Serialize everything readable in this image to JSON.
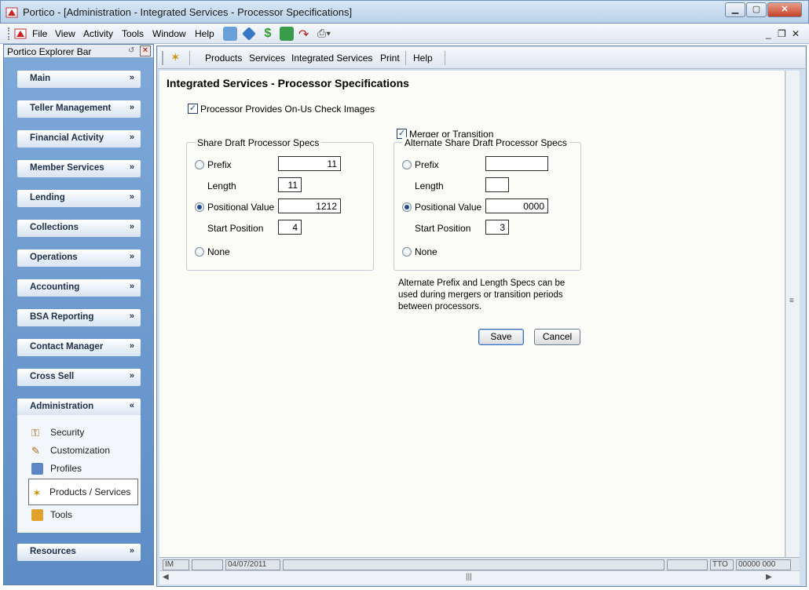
{
  "window": {
    "title": "Portico - [Administration - Integrated Services - Processor Specifications]",
    "min": "▁",
    "max": "▢",
    "close": "✕"
  },
  "menubar": {
    "items": [
      "File",
      "View",
      "Activity",
      "Tools",
      "Window",
      "Help"
    ],
    "mdi_min": "_",
    "mdi_restore": "❐",
    "mdi_close": "✕"
  },
  "explorer": {
    "title": "Portico Explorer Bar",
    "groups": [
      {
        "label": "Main",
        "chevron": "»"
      },
      {
        "label": "Teller Management",
        "chevron": "»"
      },
      {
        "label": "Financial Activity",
        "chevron": "»"
      },
      {
        "label": "Member Services",
        "chevron": "»"
      },
      {
        "label": "Lending",
        "chevron": "»"
      },
      {
        "label": "Collections",
        "chevron": "»"
      },
      {
        "label": "Operations",
        "chevron": "»"
      },
      {
        "label": "Accounting",
        "chevron": "»"
      },
      {
        "label": "BSA Reporting",
        "chevron": "»"
      },
      {
        "label": "Contact Manager",
        "chevron": "»"
      },
      {
        "label": "Cross Sell",
        "chevron": "»"
      },
      {
        "label": "Administration",
        "chevron": "«"
      },
      {
        "label": "Resources",
        "chevron": "»"
      }
    ],
    "admin_items": [
      "Security",
      "Customization",
      "Profiles",
      "Products / Services",
      "Tools"
    ],
    "selected_item": "Products / Services"
  },
  "toolbar": {
    "items": [
      "Products",
      "Services",
      "Integrated Services",
      "Print",
      "Help"
    ]
  },
  "form": {
    "title": "Integrated Services - Processor Specifications",
    "onus_label": "Processor Provides On-Us Check Images",
    "onus_checked": true,
    "merger_label": "Merger or Transition",
    "merger_checked": true,
    "primary": {
      "legend": "Share Draft Processor Specs",
      "prefix_label": "Prefix",
      "prefix_value": "11",
      "length_label": "Length",
      "length_value": "11",
      "positional_label": "Positional Value",
      "positional_value": "1212",
      "start_label": "Start Position",
      "start_value": "4",
      "none_label": "None",
      "selected": "Positional Value"
    },
    "alternate": {
      "legend": "Alternate Share Draft Processor Specs",
      "prefix_label": "Prefix",
      "prefix_value": "",
      "length_label": "Length",
      "length_value": "",
      "positional_label": "Positional Value",
      "positional_value": "0000",
      "start_label": "Start Position",
      "start_value": "3",
      "none_label": "None",
      "selected": "Positional Value"
    },
    "note": "Alternate Prefix and Length Specs can be used during mergers or transition periods between processors.",
    "save_label": "Save",
    "cancel_label": "Cancel"
  },
  "status": {
    "cells": [
      "IM",
      "",
      "04/07/2011",
      "",
      "",
      "TTO",
      "00000 000"
    ]
  },
  "colors": {
    "accent": "#214c8f",
    "explorer_bg": "#6f9ad0",
    "content_bg": "#fbfbf7"
  }
}
